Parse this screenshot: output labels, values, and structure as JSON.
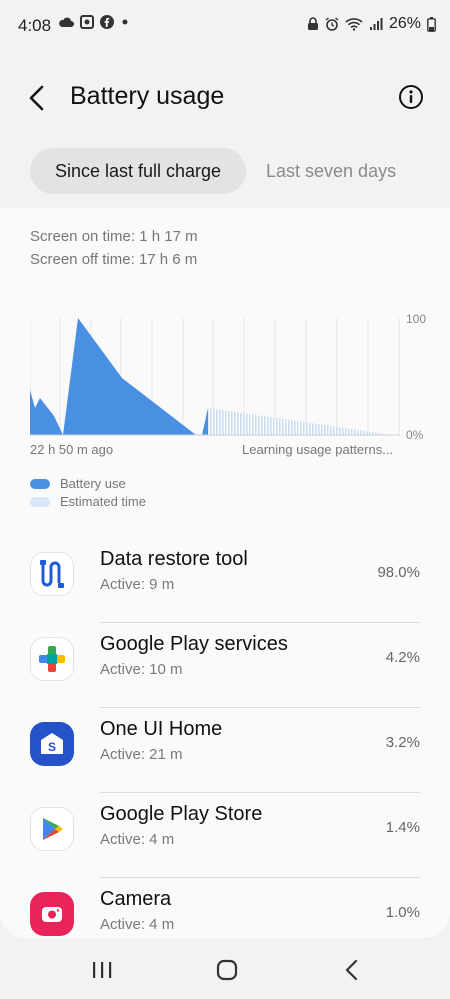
{
  "status": {
    "time": "4:08",
    "battery": "26%",
    "left_icons": [
      "cloud-icon",
      "screenshot-icon",
      "facebook-icon",
      "dot-icon"
    ],
    "right_icons": [
      "lock-icon",
      "alarm-icon",
      "wifi-icon",
      "signal-icon",
      "battery-icon"
    ]
  },
  "header": {
    "title": "Battery usage"
  },
  "tabs": [
    {
      "label": "Since last full charge",
      "active": true
    },
    {
      "label": "Last seven days",
      "active": false
    }
  ],
  "screen": {
    "on": "Screen on time: 1 h 17 m",
    "off": "Screen off time: 17 h 6 m"
  },
  "chart_data": {
    "type": "area",
    "y_labels": [
      "100",
      "0%"
    ],
    "x_labels": [
      "22 h 50 m ago",
      "Learning usage patterns..."
    ],
    "series": [
      {
        "name": "Battery use",
        "color": "#4a90e2"
      },
      {
        "name": "Estimated time",
        "color": "#c9dcf3"
      }
    ]
  },
  "legend": [
    {
      "label": "Battery use",
      "color": "#4a90e2"
    },
    {
      "label": "Estimated time",
      "color": "#d6e6f8"
    }
  ],
  "apps": [
    {
      "name": "Data restore tool",
      "active": "Active: 9 m",
      "pct": "98.0%",
      "icon": "data-restore-icon"
    },
    {
      "name": "Google Play services",
      "active": "Active: 10 m",
      "pct": "4.2%",
      "icon": "play-services-icon"
    },
    {
      "name": "One UI Home",
      "active": "Active: 21 m",
      "pct": "3.2%",
      "icon": "one-ui-home-icon"
    },
    {
      "name": "Google Play Store",
      "active": "Active: 4 m",
      "pct": "1.4%",
      "icon": "play-store-icon"
    },
    {
      "name": "Camera",
      "active": "Active: 4 m",
      "pct": "1.0%",
      "icon": "camera-icon"
    }
  ],
  "colors": {
    "accent": "#4a90e2",
    "estimate": "#c9dcf3"
  }
}
